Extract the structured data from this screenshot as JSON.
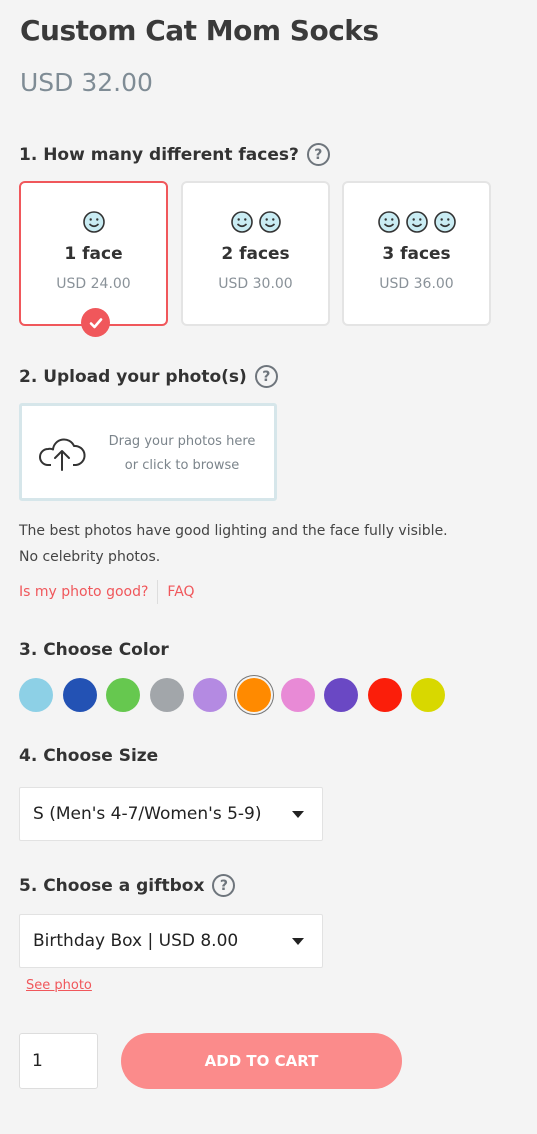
{
  "product": {
    "title": "Custom Cat Mom Socks",
    "price": "USD 32.00"
  },
  "faces": {
    "label": "1. How many different faces?",
    "help": "?",
    "options": [
      {
        "label": "1 face",
        "price": "USD 24.00",
        "count": 1,
        "selected": true
      },
      {
        "label": "2 faces",
        "price": "USD 30.00",
        "count": 2,
        "selected": false
      },
      {
        "label": "3 faces",
        "price": "USD 36.00",
        "count": 3,
        "selected": false
      }
    ]
  },
  "upload": {
    "label": "2. Upload your photo(s)",
    "help": "?",
    "line1": "Drag your photos here",
    "line2": "or click to browse",
    "hint_line1": "The best photos have good lighting and the face fully visible.",
    "hint_line2": "No celebrity photos.",
    "link_good": "Is my photo good?",
    "link_faq": "FAQ"
  },
  "color": {
    "label": "3. Choose Color",
    "swatches": [
      "#8dd0e6",
      "#2352b4",
      "#66c84f",
      "#a2a6aa",
      "#b48ae2",
      "#ff8a00",
      "#e88ad6",
      "#6a48c4",
      "#fb1e0a",
      "#d8d800"
    ],
    "selected_index": 5
  },
  "size": {
    "label": "4. Choose Size",
    "value": "S (Men's 4-7/Women's 5-9)"
  },
  "giftbox": {
    "label": "5. Choose a giftbox",
    "help": "?",
    "value": "Birthday Box | USD 8.00",
    "see_photo": "See photo"
  },
  "cart": {
    "quantity": "1",
    "button": "ADD TO CART"
  },
  "colors": {
    "accent": "#f0575b",
    "button": "#fb8b8b"
  }
}
